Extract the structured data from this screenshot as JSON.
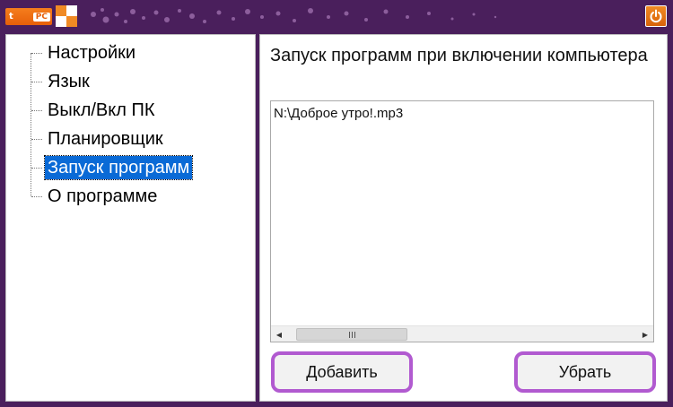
{
  "titlebar": {
    "logo_text": "t",
    "logo_badge": "PC",
    "power_icon": "power-icon",
    "accent_color": "#4a1f5c",
    "button_color": "#e8721a"
  },
  "tree": {
    "items": [
      {
        "label": "Настройки",
        "selected": false
      },
      {
        "label": "Язык",
        "selected": false
      },
      {
        "label": "Выкл/Вкл ПК",
        "selected": false
      },
      {
        "label": "Планировщик",
        "selected": false
      },
      {
        "label": "Запуск программ",
        "selected": true
      },
      {
        "label": "О программе",
        "selected": false
      }
    ]
  },
  "panel": {
    "title": "Запуск программ при включении компьютера",
    "list": [
      "N:\\Доброе утро!.mp3"
    ],
    "scroll_left_icon": "scroll-left-arrow-icon",
    "scroll_right_icon": "scroll-right-arrow-icon",
    "add_label": "Добавить",
    "remove_label": "Убрать",
    "button_border_color": "#b15ad0",
    "selection_color": "#0a6ad6"
  }
}
